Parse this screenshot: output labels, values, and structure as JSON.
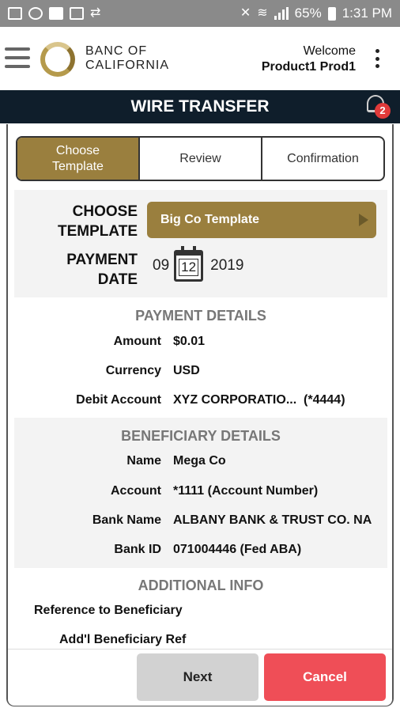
{
  "status_bar": {
    "battery": "65%",
    "time": "1:31 PM"
  },
  "header": {
    "logo_line1": "BANC OF",
    "logo_line2": "CALIFORNIA",
    "welcome": "Welcome",
    "user": "Product1 Prod1"
  },
  "title_bar": {
    "title": "WIRE TRANSFER",
    "notification_count": "2"
  },
  "steps": [
    {
      "label": "Choose Template",
      "active": true
    },
    {
      "label": "Review",
      "active": false
    },
    {
      "label": "Confirmation",
      "active": false
    }
  ],
  "choose_template": {
    "label_line1": "CHOOSE",
    "label_line2": "TEMPLATE",
    "value": "Big Co Template"
  },
  "payment_date": {
    "label_line1": "PAYMENT",
    "label_line2": "DATE",
    "month": "09",
    "day": "12",
    "year": "2019"
  },
  "payment_details": {
    "heading": "PAYMENT DETAILS",
    "amount_label": "Amount",
    "amount": "$0.01",
    "currency_label": "Currency",
    "currency": "USD",
    "debit_label": "Debit Account",
    "debit_value": "XYZ CORPORATIO...  (*4444)"
  },
  "beneficiary_details": {
    "heading": "BENEFICIARY DETAILS",
    "name_label": "Name",
    "name": "Mega Co",
    "account_label": "Account",
    "account": "*1111 (Account Number)",
    "bank_name_label": "Bank Name",
    "bank_name": "ALBANY BANK & TRUST CO. NA",
    "bank_id_label": "Bank ID",
    "bank_id": "071004446 (Fed ABA)"
  },
  "additional_info": {
    "heading": "ADDITIONAL INFO",
    "ref_label": "Reference to Beneficiary",
    "addl_ref_label": "Add'l Beneficiary Ref"
  },
  "actions": {
    "next": "Next",
    "cancel": "Cancel"
  },
  "colors": {
    "accent_gold": "#9a7f3e",
    "title_bar": "#0f1e2b",
    "cancel_red": "#ef4e57",
    "badge_red": "#e03a3a"
  }
}
